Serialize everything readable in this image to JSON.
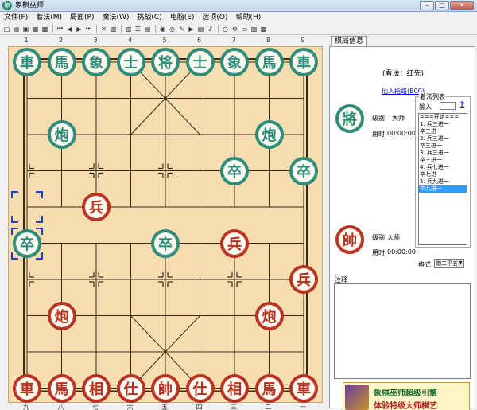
{
  "window": {
    "title": "象棋巫师",
    "controls": [
      "–",
      "□",
      "✕"
    ]
  },
  "menu": [
    "文件(F)",
    "着法(M)",
    "局面(P)",
    "魔法(W)",
    "挑战(C)",
    "电脑(E)",
    "选项(O)",
    "帮助(H)"
  ],
  "toolbar": [
    {
      "icon": "new-icon",
      "glyph": "□"
    },
    {
      "icon": "open-icon",
      "glyph": "▤"
    },
    {
      "icon": "save-icon",
      "glyph": "▣"
    },
    {
      "icon": "save-as-icon",
      "glyph": "▦"
    },
    {
      "icon": "print-icon",
      "glyph": "▩"
    },
    {
      "sep": true
    },
    {
      "icon": "first-move-icon",
      "glyph": "⏮"
    },
    {
      "icon": "prev-move-icon",
      "glyph": "◀"
    },
    {
      "icon": "next-move-icon",
      "glyph": "▶"
    },
    {
      "icon": "last-move-icon",
      "glyph": "⏭"
    },
    {
      "sep": true
    },
    {
      "icon": "delete-icon",
      "glyph": "✕"
    },
    {
      "icon": "paste-icon",
      "glyph": "▧"
    },
    {
      "sep": true
    },
    {
      "icon": "book-icon",
      "glyph": "▥"
    },
    {
      "icon": "list-icon",
      "glyph": "☰"
    },
    {
      "icon": "tree-icon",
      "glyph": "▤"
    },
    {
      "sep": true
    },
    {
      "icon": "color-icon",
      "glyph": "◉"
    },
    {
      "icon": "eye-icon",
      "glyph": "◎"
    },
    {
      "icon": "edit-icon",
      "glyph": "✎"
    },
    {
      "icon": "play-icon",
      "glyph": "▶"
    },
    {
      "icon": "options-icon",
      "glyph": "▤"
    },
    {
      "icon": "sound-icon",
      "glyph": "♪"
    },
    {
      "sep": true
    },
    {
      "icon": "timer-icon",
      "glyph": "◷"
    },
    {
      "icon": "settings-icon",
      "glyph": "⚙"
    },
    {
      "icon": "window-icon",
      "glyph": "▭"
    },
    {
      "icon": "image-icon",
      "glyph": "▨"
    },
    {
      "icon": "export-icon",
      "glyph": "▩"
    }
  ],
  "colors": {
    "black_piece": "#2b8a78",
    "red_piece": "#b83020",
    "board": "#f6ddb0",
    "selection": "#1f3fd0"
  },
  "board": {
    "top_coords": [
      "1",
      "2",
      "3",
      "4",
      "5",
      "6",
      "7",
      "8",
      "9"
    ],
    "bottom_coords": [
      "九",
      "八",
      "七",
      "六",
      "五",
      "四",
      "三",
      "二",
      "一"
    ],
    "pieces": [
      {
        "side": "black",
        "char": "車",
        "col": 0,
        "row": 0
      },
      {
        "side": "black",
        "char": "馬",
        "col": 1,
        "row": 0
      },
      {
        "side": "black",
        "char": "象",
        "col": 2,
        "row": 0
      },
      {
        "side": "black",
        "char": "士",
        "col": 3,
        "row": 0
      },
      {
        "side": "black",
        "char": "将",
        "col": 4,
        "row": 0
      },
      {
        "side": "black",
        "char": "士",
        "col": 5,
        "row": 0
      },
      {
        "side": "black",
        "char": "象",
        "col": 6,
        "row": 0
      },
      {
        "side": "black",
        "char": "馬",
        "col": 7,
        "row": 0
      },
      {
        "side": "black",
        "char": "車",
        "col": 8,
        "row": 0
      },
      {
        "side": "black",
        "char": "炮",
        "col": 1,
        "row": 2
      },
      {
        "side": "black",
        "char": "炮",
        "col": 7,
        "row": 2
      },
      {
        "side": "black",
        "char": "卒",
        "col": 6,
        "row": 3
      },
      {
        "side": "black",
        "char": "卒",
        "col": 8,
        "row": 3
      },
      {
        "side": "black",
        "char": "卒",
        "col": 0,
        "row": 5
      },
      {
        "side": "black",
        "char": "卒",
        "col": 4,
        "row": 5
      },
      {
        "side": "red",
        "char": "兵",
        "col": 2,
        "row": 4
      },
      {
        "side": "red",
        "char": "兵",
        "col": 6,
        "row": 5
      },
      {
        "side": "red",
        "char": "兵",
        "col": 8,
        "row": 6
      },
      {
        "side": "red",
        "char": "炮",
        "col": 1,
        "row": 7
      },
      {
        "side": "red",
        "char": "炮",
        "col": 7,
        "row": 7
      },
      {
        "side": "red",
        "char": "車",
        "col": 0,
        "row": 9
      },
      {
        "side": "red",
        "char": "馬",
        "col": 1,
        "row": 9
      },
      {
        "side": "red",
        "char": "相",
        "col": 2,
        "row": 9
      },
      {
        "side": "red",
        "char": "仕",
        "col": 3,
        "row": 9
      },
      {
        "side": "red",
        "char": "帥",
        "col": 4,
        "row": 9
      },
      {
        "side": "red",
        "char": "仕",
        "col": 5,
        "row": 9
      },
      {
        "side": "red",
        "char": "相",
        "col": 6,
        "row": 9
      },
      {
        "side": "red",
        "char": "馬",
        "col": 7,
        "row": 9
      },
      {
        "side": "red",
        "char": "車",
        "col": 8,
        "row": 9
      }
    ],
    "selection": [
      {
        "col": 0,
        "row": 4
      },
      {
        "col": 0,
        "row": 5
      }
    ]
  },
  "panel": {
    "tab": "棋局信息",
    "mode": "(看法：红先)",
    "engine_link": "仙人指路(B00)",
    "top_player": {
      "char": "將",
      "level_label": "级别",
      "level": "大师",
      "time_label": "用时",
      "time": "00:00:00"
    },
    "bottom_player": {
      "char": "帥",
      "level_label": "级别",
      "level": "大师",
      "time_label": "用时",
      "time": "00:00:00"
    },
    "move_list_title": "着法列表",
    "input_label": "输入",
    "help": "?",
    "moves": [
      "===开始===",
      "1. 兵三进一",
      "   卒三进一",
      "2. 兵三进一",
      "   卒三进一",
      "3. 兵三进一",
      "   卒三进一",
      "4. 兵七进一",
      "   卒七进一",
      "5. 兵九进一",
      "   卒九进一"
    ],
    "selected_move": 10,
    "format_label": "格式",
    "format_value": "炮二平五",
    "notes_label": "注释",
    "banner": {
      "line1": "象棋巫师超级引擎",
      "line2": "体验特级大师棋艺"
    }
  }
}
